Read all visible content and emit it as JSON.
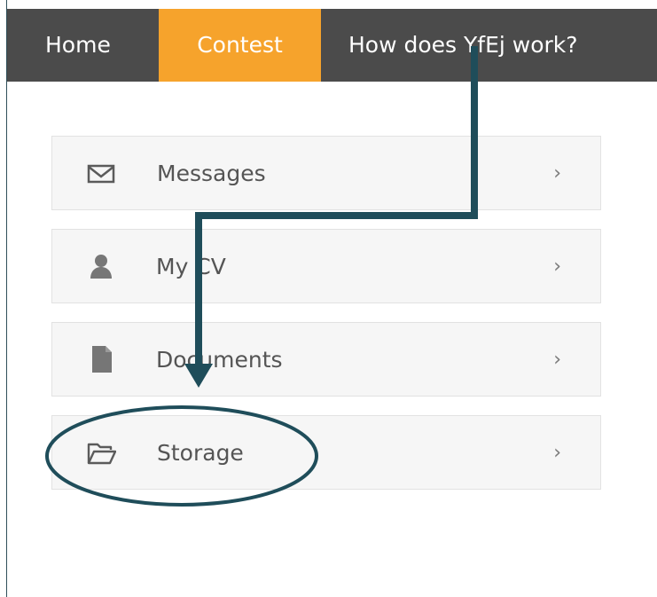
{
  "nav": {
    "items": [
      {
        "label": "Home"
      },
      {
        "label": "Contest"
      },
      {
        "label": "How does YfEj work?"
      }
    ],
    "active_color": "#f6a32c",
    "bar_color": "#4b4b4b"
  },
  "menu": {
    "items": [
      {
        "label": "Messages",
        "icon": "envelope-icon",
        "chevron": "›"
      },
      {
        "label": "My CV",
        "icon": "user-icon",
        "chevron": "›"
      },
      {
        "label": "Documents",
        "icon": "document-icon",
        "chevron": "›"
      },
      {
        "label": "Storage",
        "icon": "folder-open-icon",
        "chevron": "›"
      }
    ]
  },
  "annotation": {
    "color": "#1f4d5a"
  }
}
